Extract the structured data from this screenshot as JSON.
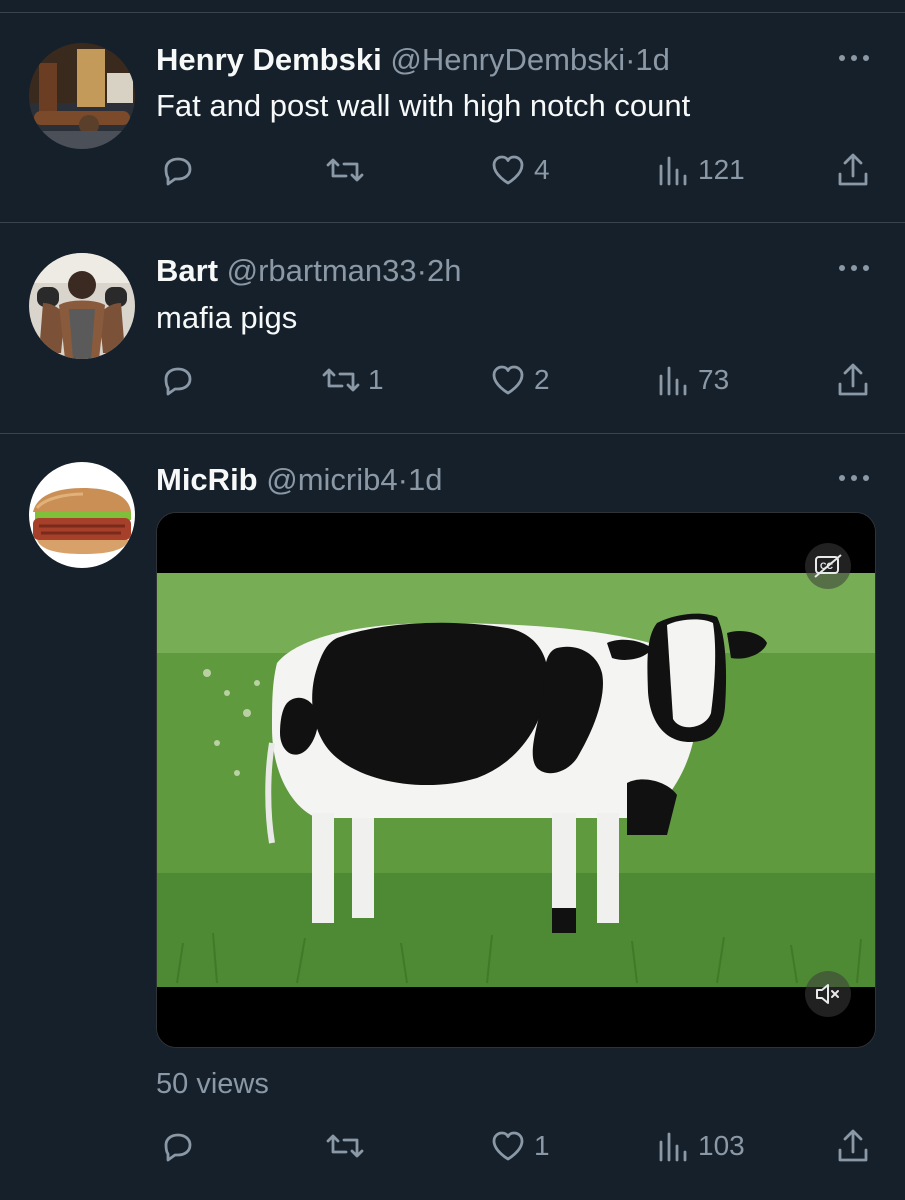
{
  "colors": {
    "background": "#15202b",
    "text": "#f7f9f9",
    "muted": "#8b98a5",
    "divider": "#38444d"
  },
  "tweets": [
    {
      "name": "Henry Dembski",
      "handle": "@HenryDembski",
      "sep": "·",
      "time": "1d",
      "text": "Fat and post wall with high notch count",
      "avatar_icon": "cigar-box-avatar",
      "reply_count": "",
      "retweet_count": "",
      "like_count": "4",
      "view_count": "121"
    },
    {
      "name": "Bart",
      "handle": "@rbartman33",
      "sep": "·",
      "time": "2h",
      "text": "mafia pigs",
      "avatar_icon": "gym-lifter-avatar",
      "reply_count": "",
      "retweet_count": "1",
      "like_count": "2",
      "view_count": "73"
    },
    {
      "name": "MicRib",
      "handle": "@micrib4",
      "sep": "·",
      "time": "1d",
      "text": "",
      "avatar_icon": "rib-sandwich-avatar",
      "media": {
        "subject": "cow-video",
        "caption_toggle_icon": "captions-off-icon",
        "mute_icon": "muted-speaker-icon"
      },
      "views_label": "50 views",
      "reply_count": "",
      "retweet_count": "",
      "like_count": "1",
      "view_count": "103"
    }
  ]
}
